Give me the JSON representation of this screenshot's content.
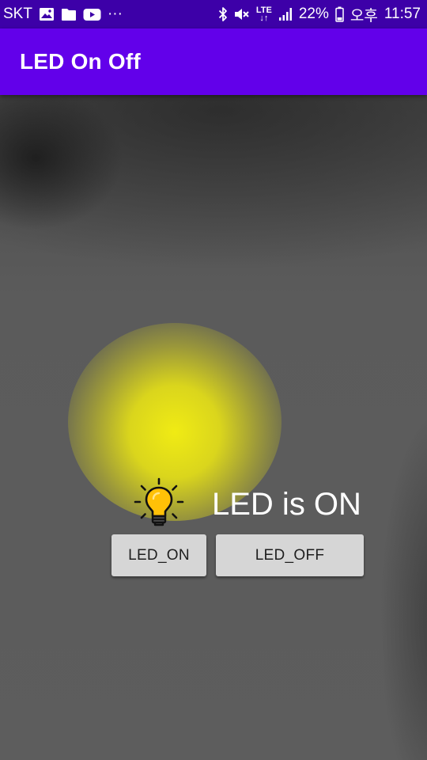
{
  "status_bar": {
    "carrier": "SKT",
    "more": "···",
    "lte": "LTE",
    "battery": "22%",
    "period": "오후",
    "time": "11:57",
    "icons": [
      "image-icon",
      "folder-icon",
      "youtube-icon",
      "bluetooth-icon",
      "mute-icon",
      "lte-icon",
      "signal-icon",
      "battery-icon"
    ]
  },
  "app_bar": {
    "title": "LED On Off"
  },
  "main": {
    "status_text": "LED is ON",
    "led_on_label": "LED_ON",
    "led_off_label": "LED_OFF",
    "bulb_icon": "lightbulb-icon"
  },
  "colors": {
    "status_bar": "#3d00a8",
    "app_bar": "#6200ea",
    "glow": "#e6e21a",
    "bulb": "#ffc107",
    "button": "#d6d6d6"
  }
}
